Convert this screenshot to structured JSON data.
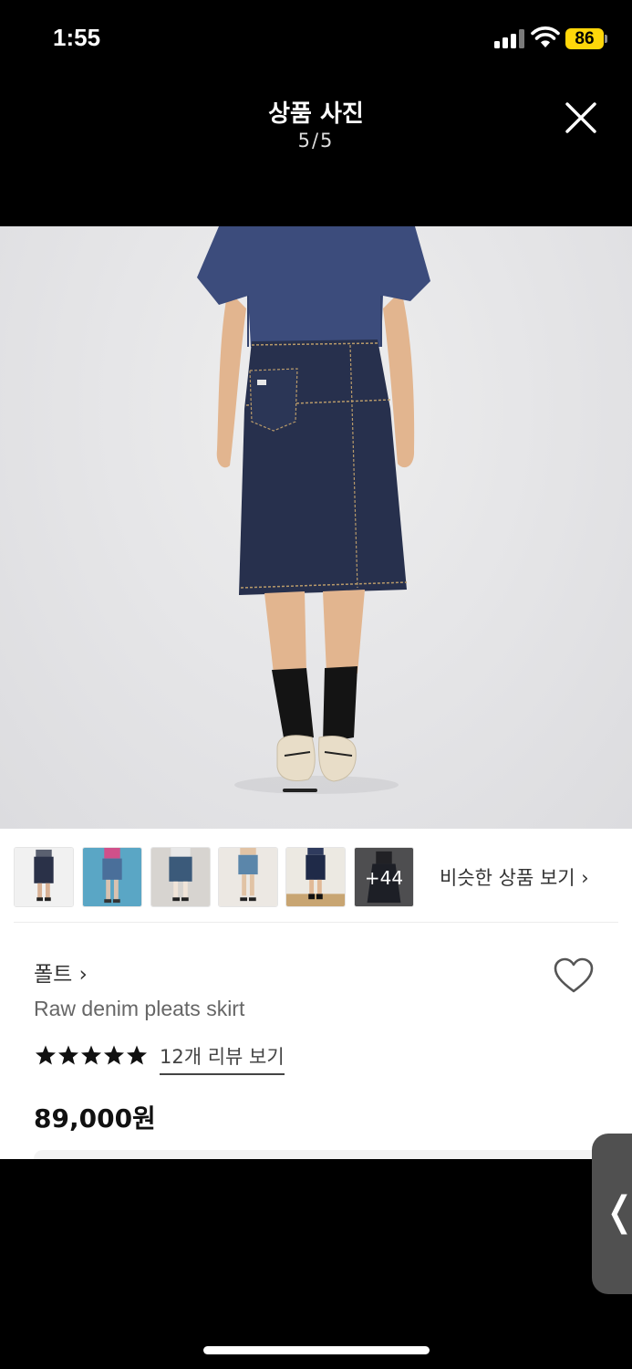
{
  "status_bar": {
    "time": "1:55",
    "battery": "86"
  },
  "header": {
    "title": "상품 사진",
    "counter": "5/5"
  },
  "photo": {
    "description_icon": "product-photo",
    "current_index": 5,
    "total": 5
  },
  "thumbnails": {
    "more_count": "+44",
    "similar_label": "비슷한 상품 보기 ›"
  },
  "product": {
    "brand": "폴트 ›",
    "name": "Raw denim pleats skirt",
    "rating_stars": 5,
    "review_link": "12개 리뷰 보기",
    "price": "89,000원"
  },
  "colors": {
    "accent_battery": "#ffd60a",
    "denim": "#2b3550",
    "background": "#000000"
  }
}
